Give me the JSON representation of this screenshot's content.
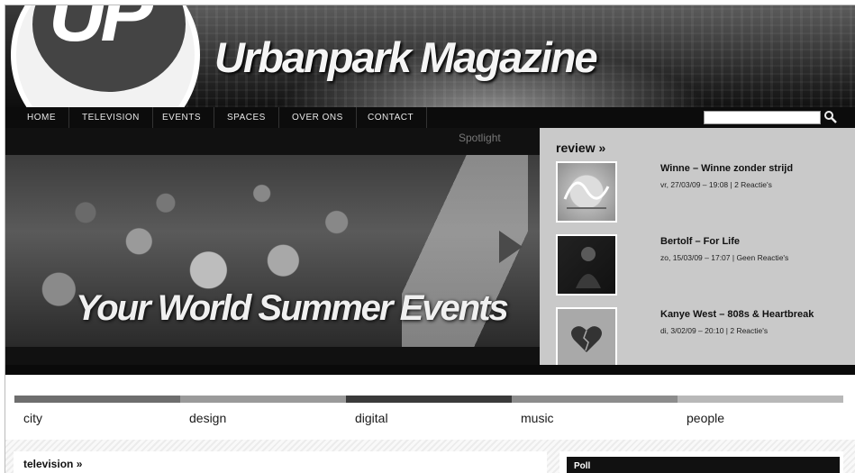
{
  "header": {
    "logo_text": "UP",
    "site_title": "Urbanpark Magazine"
  },
  "nav": {
    "items": [
      {
        "label": "HOME"
      },
      {
        "label": "TELEVISION"
      },
      {
        "label": "EVENTS"
      },
      {
        "label": "SPACES"
      },
      {
        "label": "OVER ONS"
      },
      {
        "label": "CONTACT"
      }
    ],
    "search_value": ""
  },
  "hero": {
    "label": "Spotlight",
    "caption": "Your World Summer Events"
  },
  "review": {
    "heading": "review »",
    "items": [
      {
        "title": "Winne – Winne zonder strijd",
        "meta": "vr, 27/03/09 – 19:08 | 2 Reactie's"
      },
      {
        "title": "Bertolf – For Life",
        "meta": "zo, 15/03/09 – 17:07 | Geen Reactie's"
      },
      {
        "title": "Kanye West – 808s & Heartbreak",
        "meta": "di, 3/02/09 – 20:10 | 2 Reactie's"
      }
    ]
  },
  "categories": [
    {
      "label": "city",
      "color": "#6e6e6e"
    },
    {
      "label": "design",
      "color": "#9a9a9a"
    },
    {
      "label": "digital",
      "color": "#3a3a3a"
    },
    {
      "label": "music",
      "color": "#8c8c8c"
    },
    {
      "label": "people",
      "color": "#b8b8b8"
    }
  ],
  "television": {
    "heading": "television »"
  },
  "poll": {
    "heading": "Poll"
  }
}
